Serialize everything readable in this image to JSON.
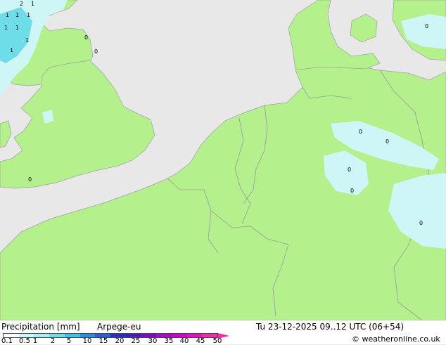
{
  "map": {
    "precip_marks": [
      "2",
      "1",
      "1",
      "1",
      "1",
      "1",
      "1",
      "1",
      "1",
      "0",
      "0",
      "0",
      "0",
      "0",
      "0",
      "0",
      "0",
      "0"
    ]
  },
  "footer": {
    "title": "Precipitation [mm]",
    "model": "Arpege-eu",
    "datetime": "Tu 23-12-2025 09..12 UTC (06+54)",
    "credit": "© weatheronline.co.uk",
    "scale_labels": [
      "0.1",
      "0.5",
      "1",
      "2",
      "5",
      "10",
      "15",
      "20",
      "25",
      "30",
      "35",
      "40",
      "45",
      "50"
    ],
    "scale_colors": [
      "#ffffff",
      "#cff6f6",
      "#a2eef0",
      "#6fdde8",
      "#3fc2e4",
      "#2c8fdc",
      "#2a5fd2",
      "#2c2fc2",
      "#4a1fb8",
      "#7a10c0",
      "#a40cc8",
      "#cc08c8",
      "#ea10c0",
      "#f030a8"
    ]
  }
}
